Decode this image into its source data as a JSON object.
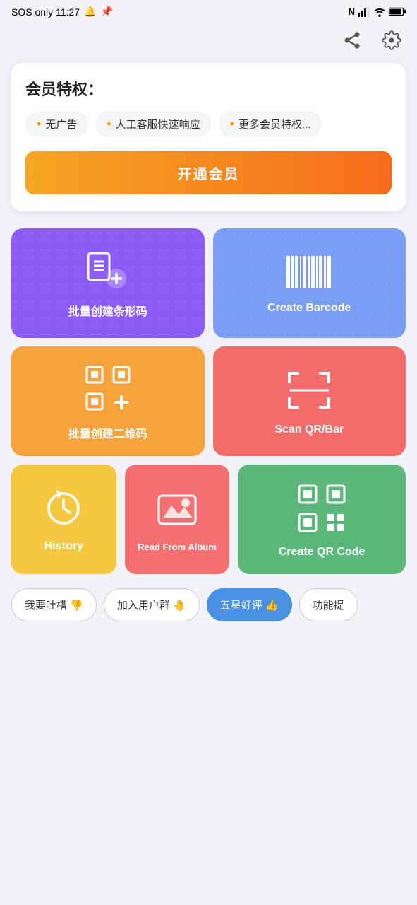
{
  "statusBar": {
    "left": "SOS only  11:27",
    "bell": "🔔",
    "pin": "📌"
  },
  "toolbar": {
    "shareIcon": "share",
    "settingsIcon": "settings"
  },
  "vip": {
    "title": "会员特权：",
    "badges": [
      "无广告",
      "人工客服快速响应",
      "更多会员特权..."
    ],
    "buttonLabel": "开通会员"
  },
  "grid": [
    {
      "id": "batch-barcode",
      "label": "批量创建条形码",
      "color": "purple",
      "icon": "barcode-create"
    },
    {
      "id": "create-barcode",
      "label": "Create Barcode",
      "color": "blue-purple",
      "icon": "barcode"
    },
    {
      "id": "batch-qr",
      "label": "批量创建二维码",
      "color": "orange",
      "icon": "qr-batch"
    },
    {
      "id": "scan-qr",
      "label": "Scan QR/Bar",
      "color": "red",
      "icon": "scan"
    }
  ],
  "bottomGrid": [
    {
      "id": "history",
      "label": "History",
      "color": "yellow",
      "icon": "clock"
    },
    {
      "id": "read-album",
      "label": "Read From Album",
      "color": "salmon",
      "icon": "image"
    },
    {
      "id": "create-qr",
      "label": "Create QR Code",
      "color": "green",
      "icon": "qr-code"
    }
  ],
  "bottomBar": {
    "buttons": [
      {
        "id": "feedback",
        "label": "我要吐槽 👎",
        "style": "outline"
      },
      {
        "id": "join-group",
        "label": "加入用户群 🤚",
        "style": "outline"
      },
      {
        "id": "five-star",
        "label": "五星好评 👍",
        "style": "blue"
      },
      {
        "id": "suggest",
        "label": "功能提",
        "style": "outline"
      }
    ]
  }
}
